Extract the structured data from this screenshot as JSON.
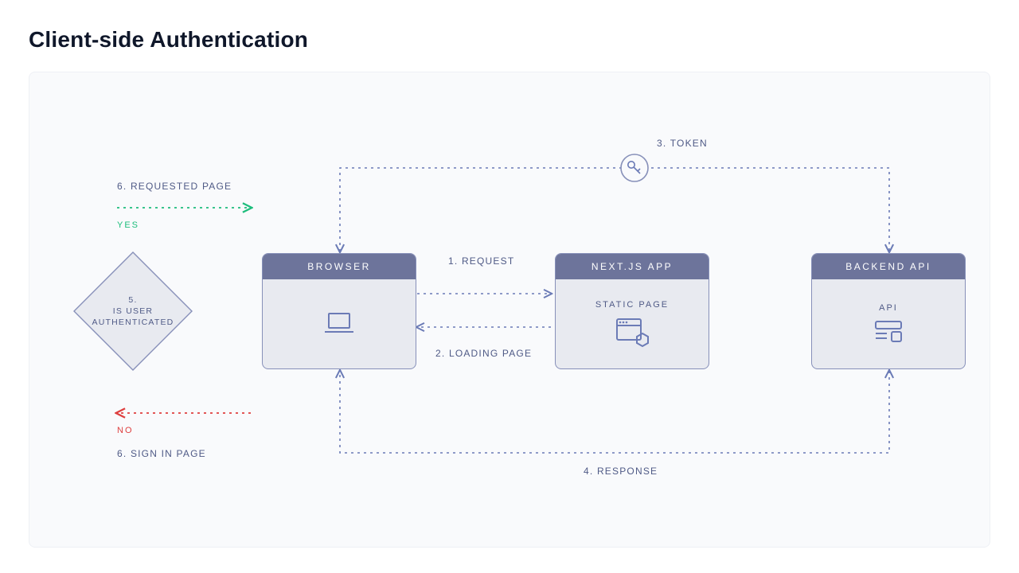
{
  "title": "Client-side Authentication",
  "labels": {
    "step1": "1. REQUEST",
    "step2": "2. LOADING PAGE",
    "step3": "3. TOKEN",
    "step4": "4. RESPONSE",
    "step6a": "6. REQUESTED PAGE",
    "step6b": "6. SIGN IN PAGE",
    "yes": "YES",
    "no": "NO"
  },
  "decision": {
    "line1": "5.",
    "line2": "IS USER",
    "line3": "AUTHENTICATED"
  },
  "cards": {
    "browser": {
      "header": "BROWSER"
    },
    "nextjs": {
      "header": "NEXT.JS APP",
      "sub": "STATIC PAGE"
    },
    "backend": {
      "header": "BACKEND API",
      "sub": "API"
    }
  },
  "colors": {
    "indigo": "#6b7bb6",
    "green": "#1dbd7c",
    "red": "#de3f3f",
    "panel_header": "#6d749b",
    "panel_bg": "#e8eaf0",
    "canvas_bg": "#f9fafc"
  }
}
